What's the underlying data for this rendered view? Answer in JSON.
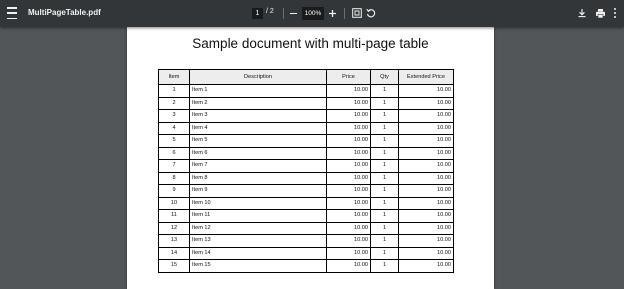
{
  "toolbar": {
    "file_title": "MultiPageTable.pdf",
    "current_page": "1",
    "page_separator": "/",
    "total_pages": "2",
    "zoom": "100%"
  },
  "document": {
    "title": "Sample document with multi-page table",
    "columns": [
      "Item",
      "Description",
      "Price",
      "Qty",
      "Extended Price"
    ],
    "rows": [
      {
        "item": "1",
        "description": "Item 1",
        "price": "10.00",
        "qty": "1",
        "extended": "10.00"
      },
      {
        "item": "2",
        "description": "Item 2",
        "price": "10.00",
        "qty": "1",
        "extended": "10.00"
      },
      {
        "item": "3",
        "description": "Item 3",
        "price": "10.00",
        "qty": "1",
        "extended": "10.00"
      },
      {
        "item": "4",
        "description": "Item 4",
        "price": "10.00",
        "qty": "1",
        "extended": "10.00"
      },
      {
        "item": "5",
        "description": "Item 5",
        "price": "10.00",
        "qty": "1",
        "extended": "10.00"
      },
      {
        "item": "6",
        "description": "Item 6",
        "price": "10.00",
        "qty": "1",
        "extended": "10.00"
      },
      {
        "item": "7",
        "description": "Item 7",
        "price": "10.00",
        "qty": "1",
        "extended": "10.00"
      },
      {
        "item": "8",
        "description": "Item 8",
        "price": "10.00",
        "qty": "1",
        "extended": "10.00"
      },
      {
        "item": "9",
        "description": "Item 9",
        "price": "10.00",
        "qty": "1",
        "extended": "10.00"
      },
      {
        "item": "10",
        "description": "Item 10",
        "price": "10.00",
        "qty": "1",
        "extended": "10.00"
      },
      {
        "item": "11",
        "description": "Item 11",
        "price": "10.00",
        "qty": "1",
        "extended": "10.00"
      },
      {
        "item": "12",
        "description": "Item 12",
        "price": "10.00",
        "qty": "1",
        "extended": "10.00"
      },
      {
        "item": "13",
        "description": "Item 13",
        "price": "10.00",
        "qty": "1",
        "extended": "10.00"
      },
      {
        "item": "14",
        "description": "Item 14",
        "price": "10.00",
        "qty": "1",
        "extended": "10.00"
      },
      {
        "item": "15",
        "description": "Item 15",
        "price": "10.00",
        "qty": "1",
        "extended": "10.00"
      }
    ]
  },
  "icons": {
    "menu": "menu-icon",
    "zoom_out": "minus-icon",
    "zoom_in": "plus-icon",
    "fit": "fit-to-page-icon",
    "rotate": "rotate-icon",
    "download": "download-icon",
    "print": "print-icon",
    "more": "more-vert-icon"
  },
  "colors": {
    "toolbar_bg": "#323639",
    "viewer_bg": "#525659",
    "page_bg": "#ffffff",
    "header_cell_bg": "#ededed"
  }
}
